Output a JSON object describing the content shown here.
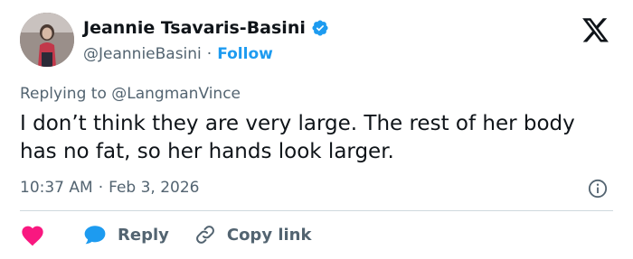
{
  "author": {
    "display_name": "Jeannie Tsavaris-Basini",
    "handle": "@JeannieBasini",
    "separator": "·",
    "follow_label": "Follow"
  },
  "reply_context": {
    "prefix": "Replying to",
    "mention": "@LangmanVince"
  },
  "tweet": {
    "text": "I don’t think they are very large. The rest of her body has no fat, so her hands look larger.",
    "time": "10:37 AM",
    "separator": "·",
    "date": "Feb 3, 2026"
  },
  "actions": {
    "reply_label": "Reply",
    "copy_link_label": "Copy link"
  },
  "icons": {
    "verified": "verified-badge-icon",
    "x_logo": "x-logo-icon",
    "info": "info-icon",
    "heart": "heart-icon",
    "reply": "speech-bubble-icon",
    "link": "link-icon"
  },
  "colors": {
    "accent": "#1d9bf0",
    "heart": "#f91880",
    "muted_text": "#536471",
    "primary_text": "#0f1419",
    "divider": "#cfd9de"
  }
}
